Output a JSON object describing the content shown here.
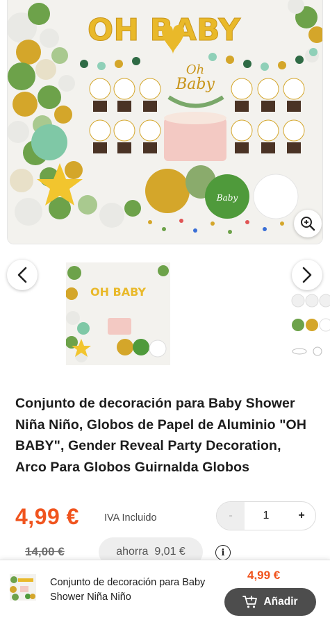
{
  "product": {
    "title": "Conjunto de decoración para Baby Shower Niña Niño, Globos de Papel de Aluminio \"OH BABY\", Gender Reveal Party Decoration, Arco Para Globos Guirnalda Globos",
    "image_banner_text": "OH BABY",
    "cake_topper_line1": "Oh",
    "cake_topper_line2": "Baby",
    "balloon_text": "Baby"
  },
  "gallery": {
    "prev_icon": "chevron-left-icon",
    "next_icon": "chevron-right-icon",
    "zoom_icon": "zoom-in-icon"
  },
  "pricing": {
    "price": "4,99 €",
    "vat_label": "IVA Incluido",
    "old_price": "14,00 €",
    "savings": "ahorra  9,01 €",
    "info_glyph": "i"
  },
  "quantity": {
    "minus_label": "-",
    "value": "1",
    "plus_label": "+"
  },
  "sticky_bar": {
    "title": "Conjunto de decoración para Baby Shower Niña Niño",
    "price": "4,99 €",
    "add_button_label": "Añadir",
    "cart_icon": "cart-add-icon"
  },
  "colors": {
    "accent_price": "#f0541e",
    "button_dark": "#4d4d4d",
    "balloon_green": "#6da24a",
    "balloon_gold": "#d4a62a"
  }
}
